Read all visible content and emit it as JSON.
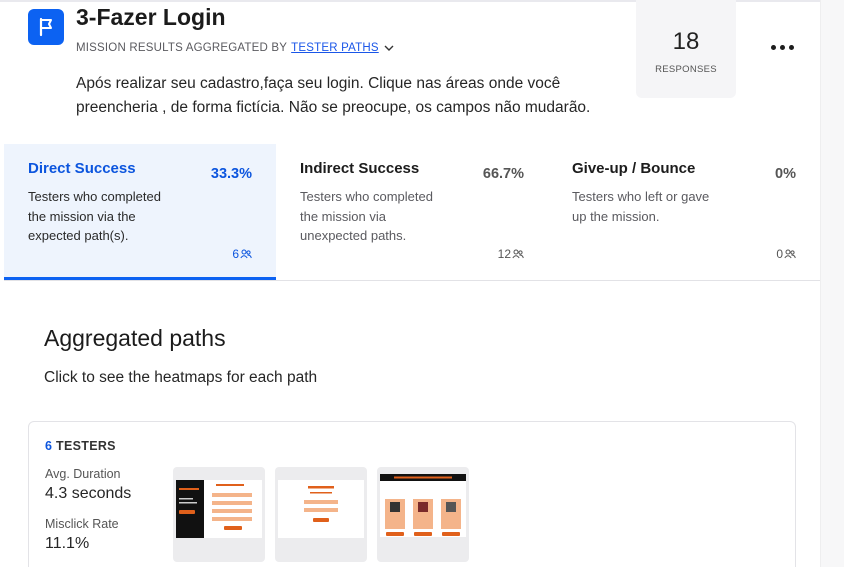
{
  "mission": {
    "title": "3-Fazer Login",
    "subtitle_prefix": "MISSION RESULTS AGGREGATED BY",
    "subtitle_link": "TESTER PATHS",
    "description": "Após realizar seu cadastro,faça seu login. Clique nas áreas onde você preencheria , de forma fictícia. Não se preocupe, os campos não mudarão."
  },
  "responses": {
    "count": "18",
    "label": "RESPONSES"
  },
  "stats": [
    {
      "title": "Direct Success",
      "percent": "33.3%",
      "description": "Testers who completed the mission via the expected path(s).",
      "count": "6"
    },
    {
      "title": "Indirect Success",
      "percent": "66.7%",
      "description": "Testers who completed the mission via unexpected paths.",
      "count": "12"
    },
    {
      "title": "Give-up / Bounce",
      "percent": "0%",
      "description": "Testers who left or gave up the mission.",
      "count": "0"
    }
  ],
  "aggregated": {
    "title": "Aggregated paths",
    "subtitle": "Click to see the heatmaps for each path"
  },
  "path": {
    "testers_count": "6",
    "testers_label": "TESTERS",
    "avg_duration_label": "Avg. Duration",
    "avg_duration_value": "4.3 seconds",
    "misclick_label": "Misclick Rate",
    "misclick_value": "11.1%"
  },
  "colors": {
    "accent": "#0c62f2",
    "accent_text": "#0c55de",
    "thumb_orange": "#e0601b",
    "thumb_peach": "#f4b48a"
  },
  "icons": [
    "flag-icon",
    "chevron-down-icon",
    "more-options-icon",
    "users-icon"
  ]
}
